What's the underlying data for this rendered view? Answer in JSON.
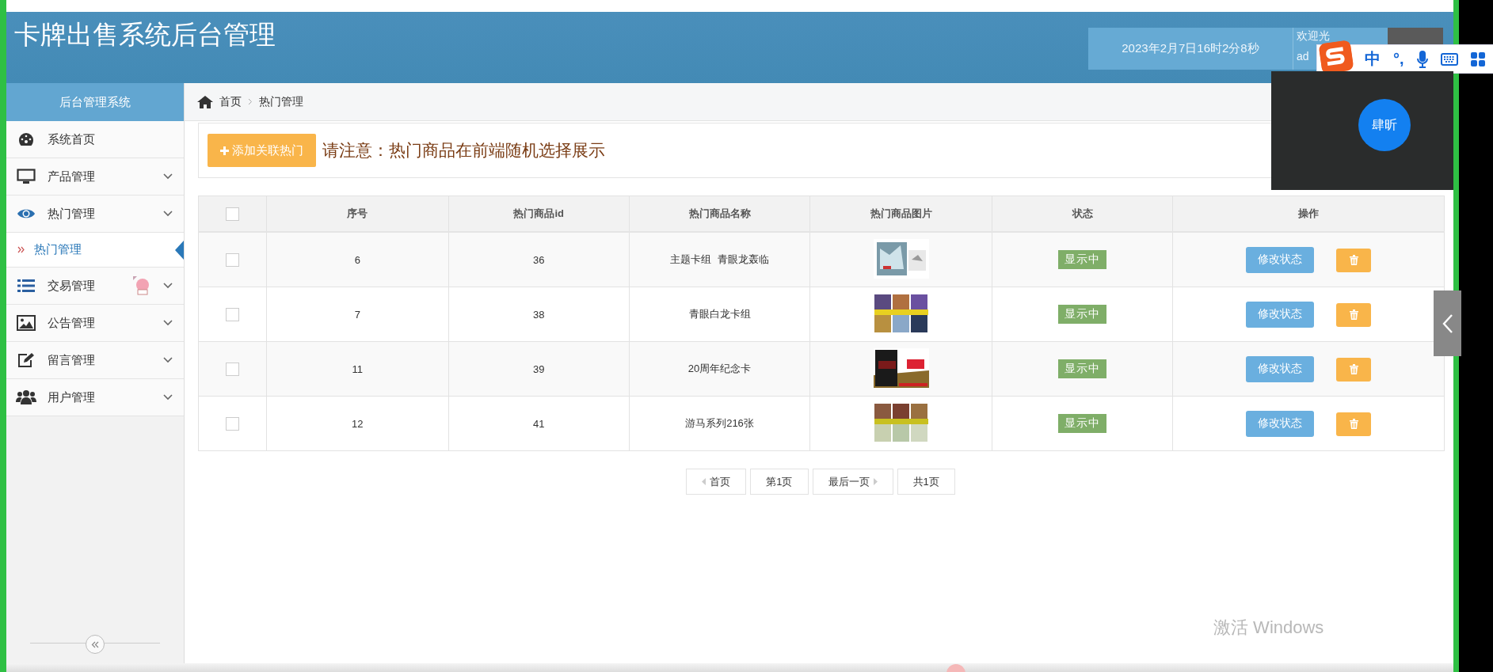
{
  "header": {
    "title": "卡牌出售系统后台管理",
    "datetime": "2023年2月7日16时2分8秒",
    "welcome": "欢迎光",
    "user": "ad"
  },
  "sidebar": {
    "title": "后台管理系统",
    "items": [
      {
        "label": "系统首页",
        "kind": "link"
      },
      {
        "label": "产品管理",
        "kind": "menu"
      },
      {
        "label": "热门管理",
        "kind": "menu",
        "children": [
          {
            "label": "热门管理",
            "selected": true
          }
        ]
      },
      {
        "label": "交易管理",
        "kind": "menu"
      },
      {
        "label": "公告管理",
        "kind": "menu"
      },
      {
        "label": "留言管理",
        "kind": "menu"
      },
      {
        "label": "用户管理",
        "kind": "menu"
      }
    ]
  },
  "breadcrumb": [
    "首页",
    "热门管理"
  ],
  "toolbar": {
    "add_button": "添加关联热门",
    "notice": "请注意：热门商品在前端随机选择展示"
  },
  "table": {
    "columns": [
      "序号",
      "热门商品id",
      "热门商品名称",
      "热门商品图片",
      "状态",
      "操作"
    ],
    "select_all_checked": false,
    "rows": [
      {
        "checked": false,
        "index": "6",
        "id": "36",
        "name": "主题卡组  青眼龙轰临",
        "status": "显示中",
        "action": "修改状态"
      },
      {
        "checked": false,
        "index": "7",
        "id": "38",
        "name": "青眼白龙卡组",
        "status": "显示中",
        "action": "修改状态"
      },
      {
        "checked": false,
        "index": "11",
        "id": "39",
        "name": "20周年纪念卡",
        "status": "显示中",
        "action": "修改状态"
      },
      {
        "checked": false,
        "index": "12",
        "id": "41",
        "name": "游马系列216张",
        "status": "显示中",
        "action": "修改状态"
      }
    ]
  },
  "pagination": [
    {
      "label": "首页",
      "kind": "prev"
    },
    {
      "label": "第1页",
      "kind": "page"
    },
    {
      "label": "最后一页",
      "kind": "next"
    },
    {
      "label": "共1页",
      "kind": "page"
    }
  ],
  "ime_toolbar": {
    "mode": "中",
    "punctuation": "°,"
  },
  "call_popup": {
    "avatar": "肆昕"
  },
  "os_notice": "激活 Windows"
}
